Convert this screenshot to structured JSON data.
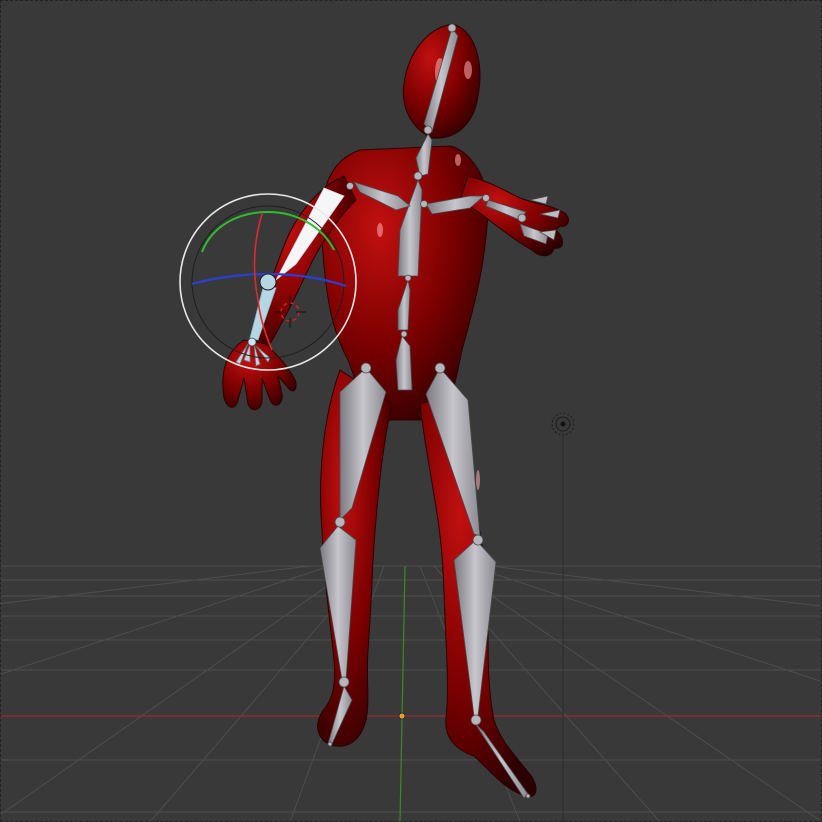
{
  "viewport": {
    "mode": "pose",
    "background": "#393939",
    "colors": {
      "grid": "#4d4d4d",
      "x_axis": "#9b2b2b",
      "y_axis": "#3c8a24",
      "mesh": "#8a0000",
      "mesh_dark": "#3a0000",
      "bone": "#a8a8ad",
      "bone_dark": "#6e6e72",
      "bone_selected": "#eef2f6",
      "gizmo_x": "#e02a2a",
      "gizmo_y": "#2fbd2f",
      "gizmo_z": "#2a3fd6",
      "gizmo_ring": "#ffffff",
      "cursor": "#d42020",
      "origin": "#e89b2a"
    },
    "icons": {
      "cursor": "3d-cursor-icon",
      "lamp": "lamp-icon",
      "origin": "object-origin-icon",
      "gizmo": "rotate-gizmo-icon"
    }
  }
}
